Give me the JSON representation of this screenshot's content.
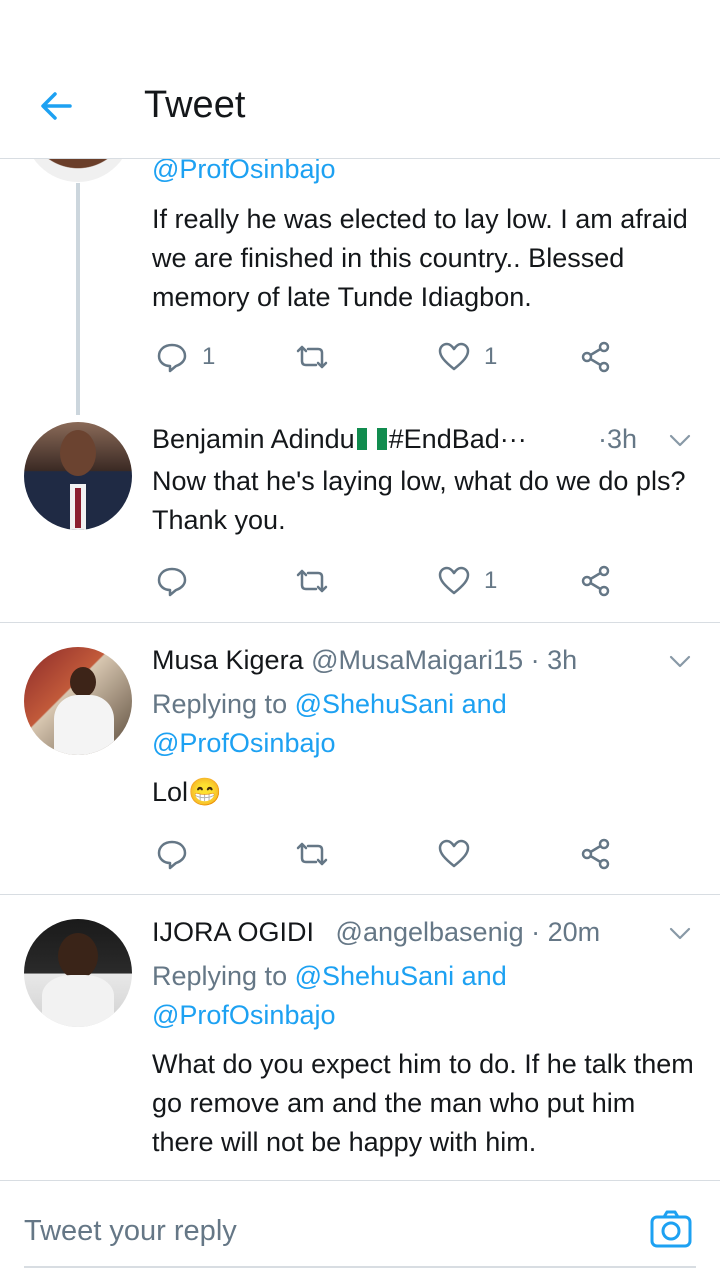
{
  "header": {
    "title": "Tweet"
  },
  "tweets": [
    {
      "handle_line": "@ProfOsinbajo",
      "text": "If really he was elected to lay low. I am afraid we are finished in this country.. Blessed memory of late Tunde Idiagbon.",
      "reply_count": "1",
      "like_count": "1"
    },
    {
      "name": "Benjamin Adindu",
      "name_suffix": "#EndBad···",
      "time": "·3h",
      "text": "Now that he's laying low, what do we do pls? Thank you.",
      "like_count": "1"
    },
    {
      "name": "Musa Kigera",
      "handle": "@MusaMaigari15",
      "time": "· 3h",
      "replying_prefix": "Replying to",
      "replying_user1": "@ShehuSani",
      "replying_and": "and",
      "replying_user2": "@ProfOsinbajo",
      "text": "Lol😁"
    },
    {
      "name": "IJORA OGIDI",
      "handle": "@angelbasenig",
      "time": "· 20m",
      "replying_prefix": "Replying to",
      "replying_user1": "@ShehuSani",
      "replying_and": "and",
      "replying_user2": "@ProfOsinbajo",
      "text": "What do you expect him to do. If he talk them go remove am and the man who put him there will not be happy with him."
    }
  ],
  "reply_bar": {
    "placeholder": "Tweet your reply"
  },
  "colors": {
    "accent": "#1da1f2",
    "muted": "#657786",
    "text": "#14171a",
    "divider": "#d8dde2"
  },
  "icons": [
    "back-arrow-icon",
    "reply-icon",
    "retweet-icon",
    "like-icon",
    "share-icon",
    "chevron-down-icon",
    "camera-icon"
  ]
}
